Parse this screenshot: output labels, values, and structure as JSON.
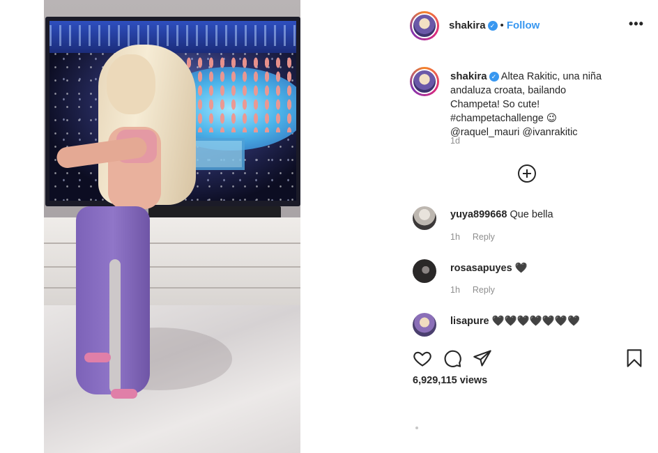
{
  "post": {
    "username": "shakira",
    "follow_label": "Follow",
    "more_label": "•••",
    "caption": {
      "username": "shakira",
      "text": "Altea Rakitic, una niña andaluza croata, bailando Champeta! So cute! #champetachallenge 😉 @raquel_mauri @ivanrakitic",
      "time": "1d"
    },
    "views": "6,929,115 views"
  },
  "comments": [
    {
      "username": "yuya899668",
      "text": "Que bella",
      "time": "1h",
      "reply_label": "Reply"
    },
    {
      "username": "rosasapuyes",
      "text": "🖤",
      "time": "1h",
      "reply_label": "Reply"
    },
    {
      "username": "lisapure",
      "text": "🖤🖤🖤🖤🖤🖤🖤"
    }
  ],
  "icons": {
    "like": "heart-icon",
    "comment": "comment-icon",
    "share": "share-icon",
    "save": "bookmark-icon",
    "load_more": "plus-circle-icon",
    "more": "more-options-icon",
    "verified": "verified-badge-icon"
  },
  "colors": {
    "link": "#3897f0",
    "verified": "#3897f0",
    "text": "#262626",
    "muted": "#8e8e8e"
  }
}
